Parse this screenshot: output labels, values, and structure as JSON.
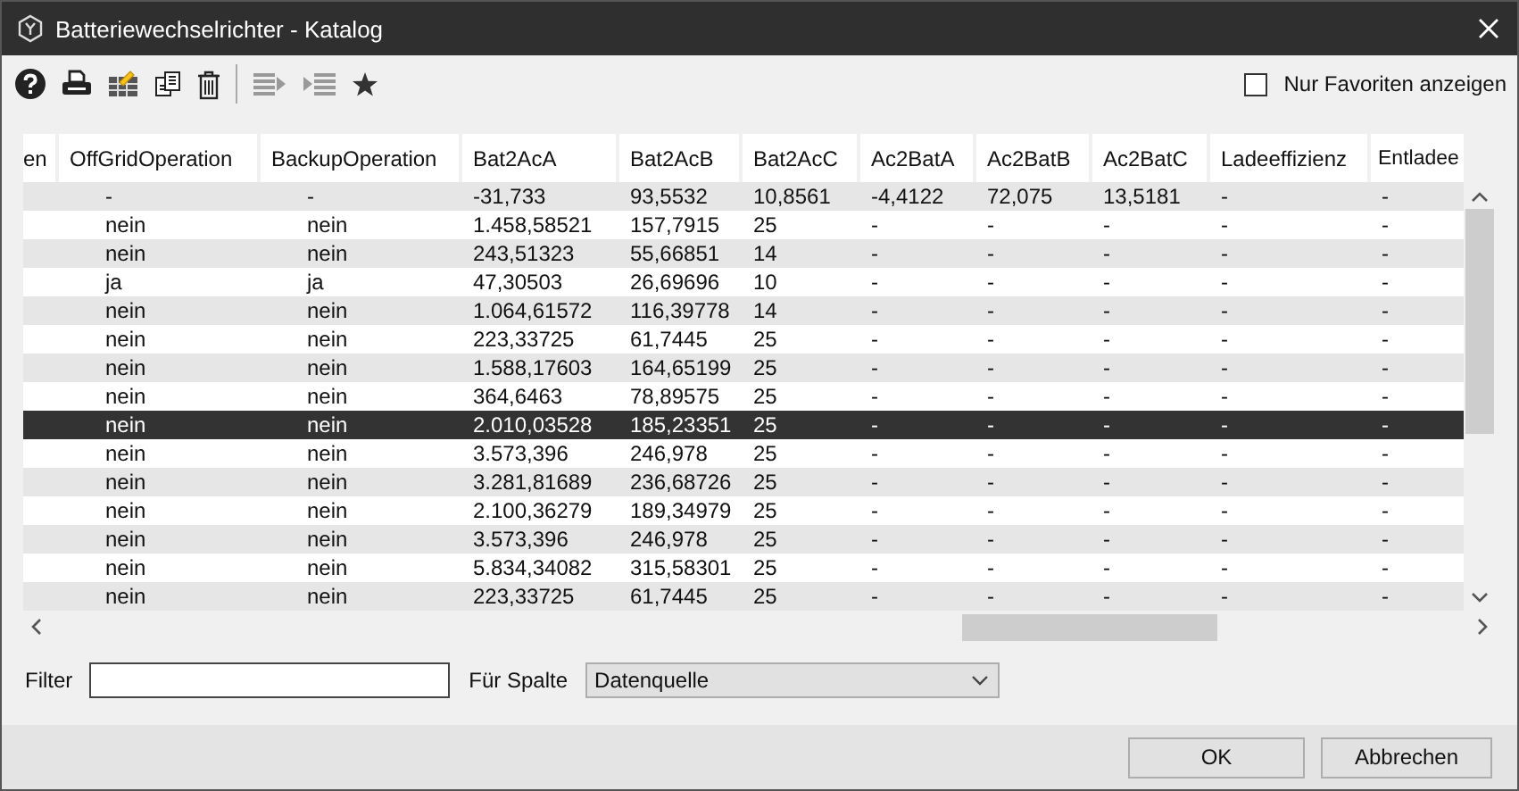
{
  "window": {
    "title": "Batteriewechselrichter - Katalog"
  },
  "toolbar": {
    "favorites_only": {
      "label": "Nur Favoriten anzeigen",
      "checked": false
    }
  },
  "table": {
    "columns": [
      "en",
      "OffGridOperation",
      "BackupOperation",
      "Bat2AcA",
      "Bat2AcB",
      "Bat2AcC",
      "Ac2BatA",
      "Ac2BatB",
      "Ac2BatC",
      "Ladeeffizienz",
      "Entladee"
    ],
    "rows": [
      {
        "selected": false,
        "cells": [
          "",
          "-",
          "-",
          "-31,733",
          "93,5532",
          "10,8561",
          "-4,4122",
          "72,075",
          "13,5181",
          "-",
          "-"
        ]
      },
      {
        "selected": false,
        "cells": [
          "",
          "nein",
          "nein",
          "1.458,58521",
          "157,7915",
          "25",
          "-",
          "-",
          "-",
          "-",
          "-"
        ]
      },
      {
        "selected": false,
        "cells": [
          "",
          "nein",
          "nein",
          "243,51323",
          "55,66851",
          "14",
          "-",
          "-",
          "-",
          "-",
          "-"
        ]
      },
      {
        "selected": false,
        "cells": [
          "",
          "ja",
          "ja",
          "47,30503",
          "26,69696",
          "10",
          "-",
          "-",
          "-",
          "-",
          "-"
        ]
      },
      {
        "selected": false,
        "cells": [
          "",
          "nein",
          "nein",
          "1.064,61572",
          "116,39778",
          "14",
          "-",
          "-",
          "-",
          "-",
          "-"
        ]
      },
      {
        "selected": false,
        "cells": [
          "",
          "nein",
          "nein",
          "223,33725",
          "61,7445",
          "25",
          "-",
          "-",
          "-",
          "-",
          "-"
        ]
      },
      {
        "selected": false,
        "cells": [
          "",
          "nein",
          "nein",
          "1.588,17603",
          "164,65199",
          "25",
          "-",
          "-",
          "-",
          "-",
          "-"
        ]
      },
      {
        "selected": false,
        "cells": [
          "",
          "nein",
          "nein",
          "364,6463",
          "78,89575",
          "25",
          "-",
          "-",
          "-",
          "-",
          "-"
        ]
      },
      {
        "selected": true,
        "cells": [
          "",
          "nein",
          "nein",
          "2.010,03528",
          "185,23351",
          "25",
          "-",
          "-",
          "-",
          "-",
          "-"
        ]
      },
      {
        "selected": false,
        "cells": [
          "",
          "nein",
          "nein",
          "3.573,396",
          "246,978",
          "25",
          "-",
          "-",
          "-",
          "-",
          "-"
        ]
      },
      {
        "selected": false,
        "cells": [
          "",
          "nein",
          "nein",
          "3.281,81689",
          "236,68726",
          "25",
          "-",
          "-",
          "-",
          "-",
          "-"
        ]
      },
      {
        "selected": false,
        "cells": [
          "",
          "nein",
          "nein",
          "2.100,36279",
          "189,34979",
          "25",
          "-",
          "-",
          "-",
          "-",
          "-"
        ]
      },
      {
        "selected": false,
        "cells": [
          "",
          "nein",
          "nein",
          "3.573,396",
          "246,978",
          "25",
          "-",
          "-",
          "-",
          "-",
          "-"
        ]
      },
      {
        "selected": false,
        "cells": [
          "",
          "nein",
          "nein",
          "5.834,34082",
          "315,58301",
          "25",
          "-",
          "-",
          "-",
          "-",
          "-"
        ]
      },
      {
        "selected": false,
        "cells": [
          "",
          "nein",
          "nein",
          "223,33725",
          "61,7445",
          "25",
          "-",
          "-",
          "-",
          "-",
          "-"
        ]
      }
    ]
  },
  "filter": {
    "label": "Filter",
    "column_label": "Für Spalte",
    "column_value": "Datenquelle"
  },
  "buttons": [
    "OK",
    "Abbrechen"
  ]
}
